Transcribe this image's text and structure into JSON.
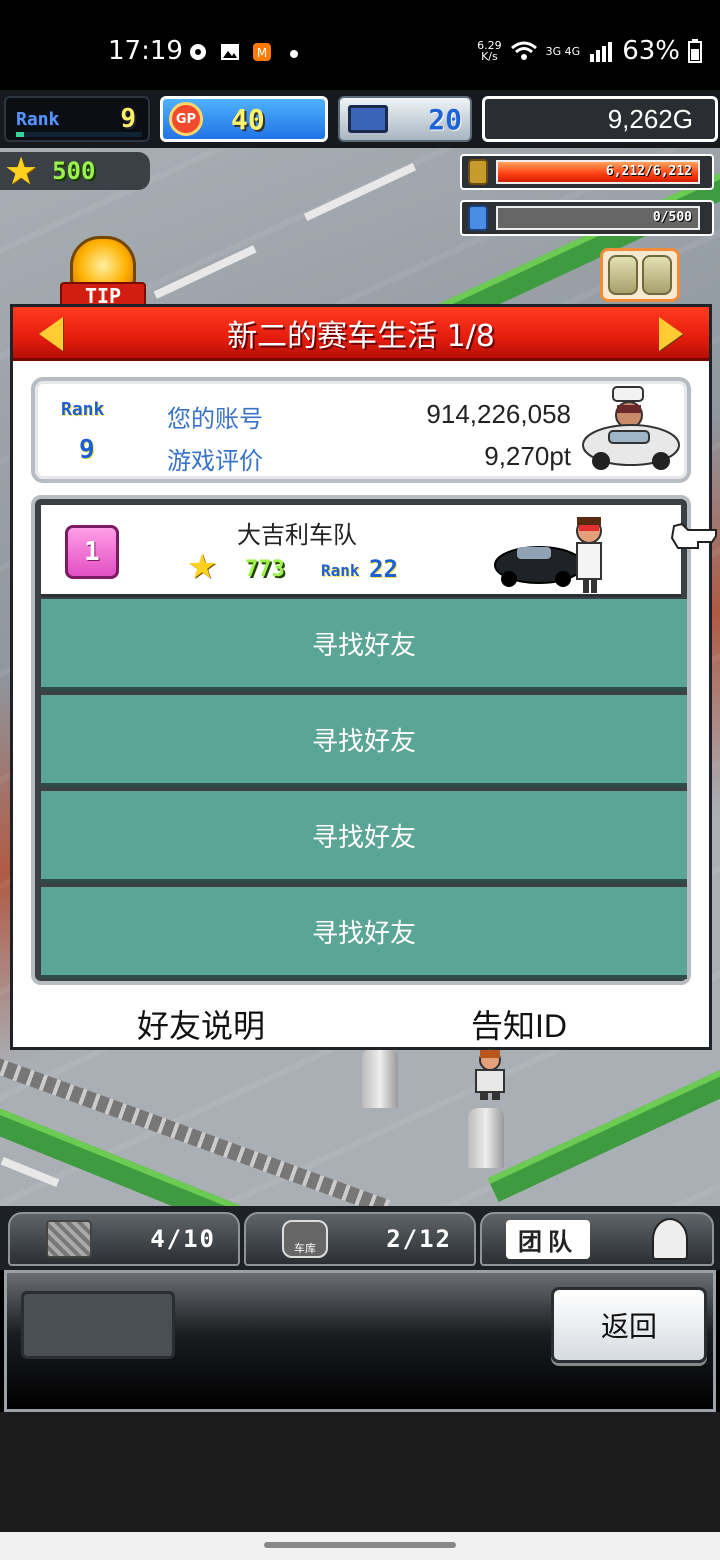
{
  "status_bar": {
    "time": "17:19",
    "net_speed_top": "6.29",
    "net_speed_bottom": "K/s",
    "signal": "3G 4G",
    "battery": "63%"
  },
  "hud": {
    "rank_label": "Rank",
    "rank_value": "9",
    "gp_icon": "GP",
    "gp_value": "40",
    "pc_value": "20",
    "money": "9,262G"
  },
  "field": {
    "stars": "500",
    "fuel": "6,212/6,212",
    "fuel_fraction": 1.0,
    "water": "0/500",
    "water_fraction": 0.0,
    "tip": "TIP"
  },
  "dialog": {
    "title": "新二的赛车生活 1/8",
    "account": {
      "rank_label": "Rank",
      "rank_value": "9",
      "account_label": "您的账号",
      "account_value": "914,226,058",
      "rating_label": "游戏评价",
      "rating_value": "9,270pt"
    },
    "team": {
      "position": "1",
      "name": "大吉利车队",
      "stars": "773",
      "rank_label": "Rank",
      "rank_value": "22"
    },
    "find_rows": [
      "寻找好友",
      "寻找好友",
      "寻找好友",
      "寻找好友"
    ],
    "friend_help": "好友说明",
    "notify_id": "告知ID"
  },
  "tabs": {
    "crate_count": "4/10",
    "garage_label": "车库",
    "garage_count": "2/12",
    "team_label": "团队"
  },
  "bottom": {
    "back_label": "返回"
  },
  "colors": {
    "header_red": "#e61d0e",
    "find_teal": "#5ba597",
    "gp_blue": "#2173e6"
  }
}
